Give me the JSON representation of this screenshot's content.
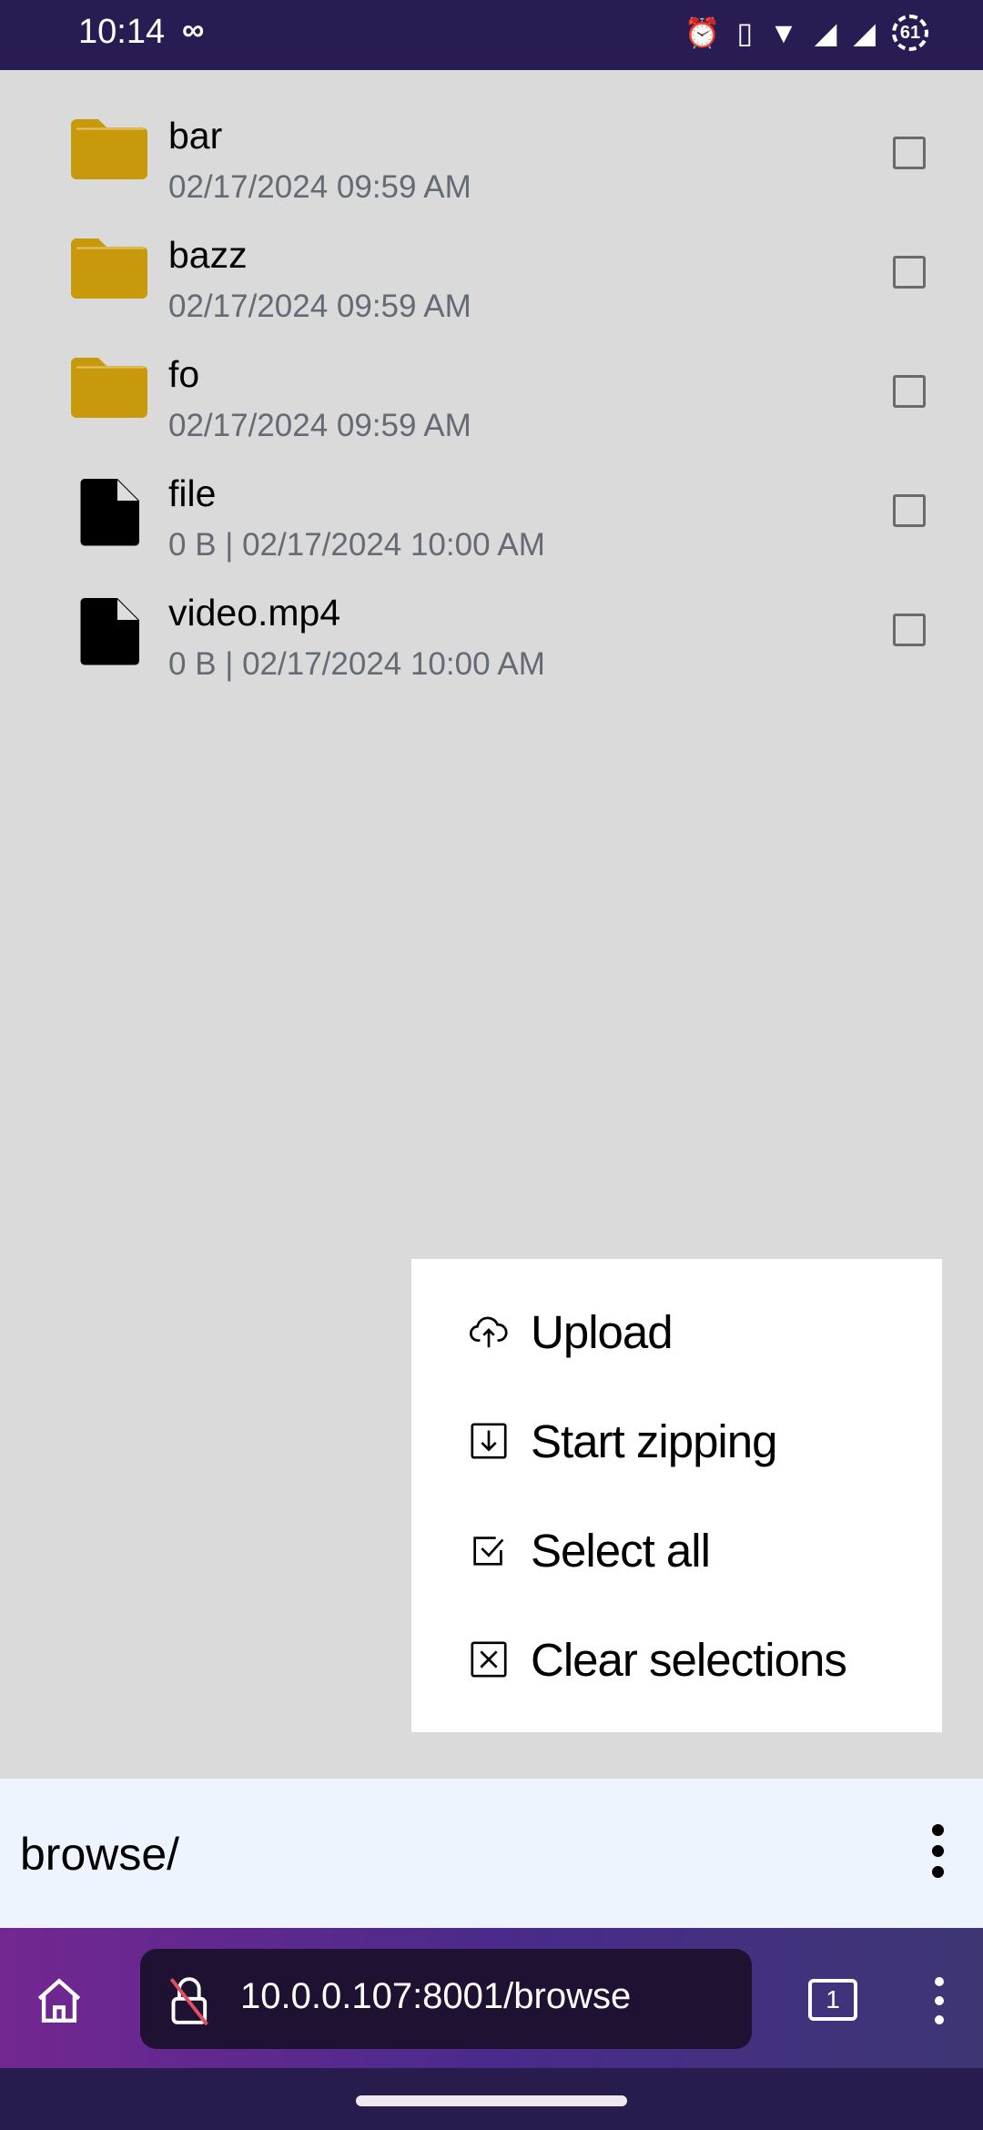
{
  "status_bar": {
    "time": "10:14",
    "battery": "61",
    "icons": [
      "infinity-icon",
      "alarm-icon",
      "vibrate-icon",
      "wifi-icon",
      "signal-icon",
      "signal-icon",
      "battery-icon"
    ]
  },
  "files": [
    {
      "name": "bar",
      "meta": "02/17/2024 09:59 AM",
      "type": "folder",
      "checked": false
    },
    {
      "name": "bazz",
      "meta": "02/17/2024 09:59 AM",
      "type": "folder",
      "checked": false
    },
    {
      "name": "fo",
      "meta": "02/17/2024 09:59 AM",
      "type": "folder",
      "checked": false
    },
    {
      "name": "file",
      "meta": "0 B | 02/17/2024 10:00 AM",
      "type": "file",
      "checked": false
    },
    {
      "name": "video.mp4",
      "meta": "0 B | 02/17/2024 10:00 AM",
      "type": "file",
      "checked": false
    }
  ],
  "menu": {
    "items": [
      {
        "label": "Upload",
        "icon": "cloud-upload-icon"
      },
      {
        "label": "Start zipping",
        "icon": "download-box-icon"
      },
      {
        "label": "Select all",
        "icon": "checkbox-checked-icon"
      },
      {
        "label": "Clear selections",
        "icon": "close-box-icon"
      }
    ]
  },
  "path_bar": {
    "path": "browse/"
  },
  "browser": {
    "url": "10.0.0.107:8001/browse",
    "tab_count": "1"
  },
  "colors": {
    "folder": "#c8990b",
    "status_bar": "#281c52",
    "path_bar": "#eef4fd"
  }
}
